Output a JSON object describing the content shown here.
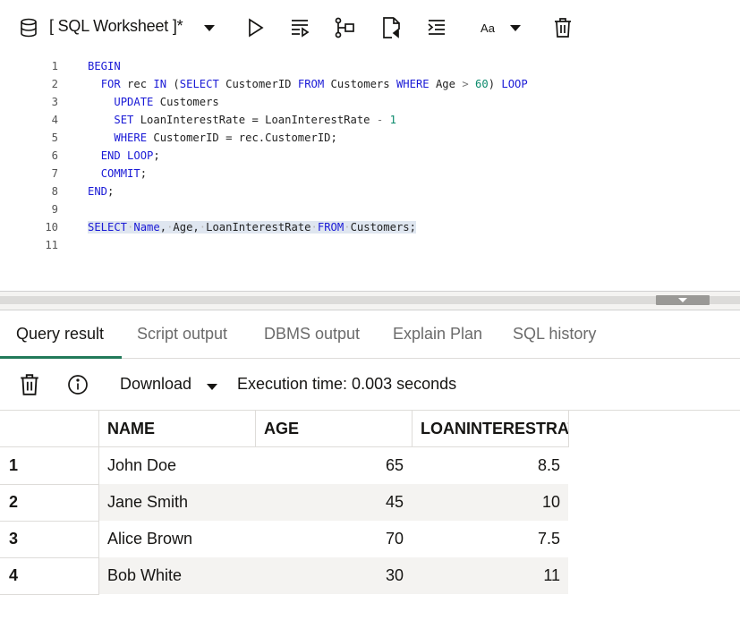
{
  "toolbar": {
    "worksheet_title": "[ SQL Worksheet ]*",
    "font_size_label": "Aa",
    "icons": [
      "database-icon",
      "chevron-down-icon",
      "run-statement-icon",
      "run-script-icon",
      "explain-plan-icon",
      "autotrace-icon",
      "indent-icon",
      "chevron-down-icon",
      "trash-icon"
    ]
  },
  "editor": {
    "line_numbers": [
      "1",
      "2",
      "3",
      "4",
      "5",
      "6",
      "7",
      "8",
      "9",
      "10",
      "11"
    ]
  },
  "tabs": [
    {
      "label": "Query result",
      "active": true
    },
    {
      "label": "Script output",
      "active": false
    },
    {
      "label": "DBMS output",
      "active": false
    },
    {
      "label": "Explain Plan",
      "active": false
    },
    {
      "label": "SQL history",
      "active": false
    }
  ],
  "result_toolbar": {
    "download_label": "Download",
    "execution_time": "Execution time: 0.003 seconds"
  },
  "grid": {
    "columns": [
      "NAME",
      "AGE",
      "LOANINTERESTRAT"
    ],
    "rows": [
      {
        "num": "1",
        "name": "John Doe",
        "age": "65",
        "rate": "8.5"
      },
      {
        "num": "2",
        "name": "Jane Smith",
        "age": "45",
        "rate": "10"
      },
      {
        "num": "3",
        "name": "Alice Brown",
        "age": "70",
        "rate": "7.5"
      },
      {
        "num": "4",
        "name": "Bob White",
        "age": "30",
        "rate": "11"
      }
    ]
  },
  "colors": {
    "keyword": "#1a1ad6",
    "number": "#0b8a6c",
    "active_tab_underline": "#227a5a",
    "selection": "#dfe6f0"
  }
}
